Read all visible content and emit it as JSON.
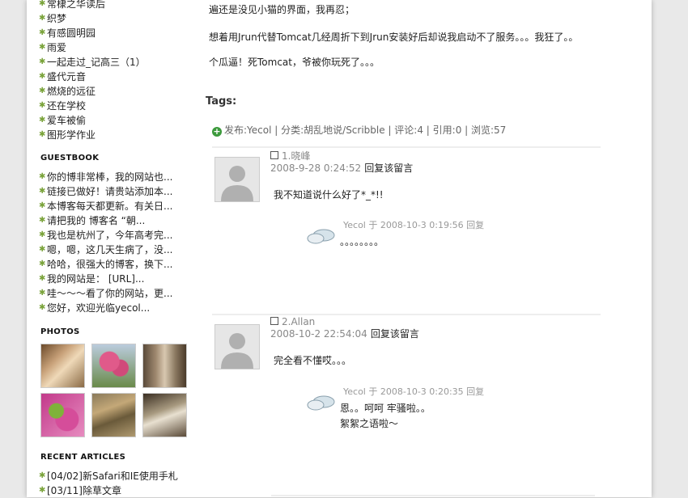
{
  "sidebar": {
    "top_links": [
      "常棣之华读后",
      "织梦",
      "有感圆明园",
      "雨爱",
      "一起走过_记高三（1）",
      "盛代元音",
      "燃烧的远征",
      "还在学校",
      "爱车被偷",
      "图形学作业"
    ],
    "guestbook_title": "GUESTBOOK",
    "guestbook": [
      "你的博非常棒，我的网站也...",
      "链接已做好！请贵站添加本...",
      "本博客每天都更新。有关日...",
      "请把我的 博客名 “朝...",
      "我也是杭州了，今年高考完...",
      "嗯，嗯，这几天生病了，没...",
      "哈哈，很强大的博客，换下...",
      "我的网站是： [URL]...",
      "哇～～～看了你的网站，更...",
      "您好，欢迎光临yecol..."
    ],
    "photos_title": "PHOTOS",
    "photos": [
      "book-photo",
      "pink-flowers-photo",
      "alley-photo",
      "pink-blossom-photo",
      "leaves-photo",
      "sign-photo"
    ],
    "recent_title": "RECENT ARTICLES",
    "recent": [
      "[04/02]新Safari和IE使用手札",
      "[03/11]除草文章"
    ]
  },
  "post": {
    "lines": [
      "遍还是没见小猫的界面，我再忍；",
      "想着用Jrun代替Tomcat几经周折下到Jrun安装好后却说我启动不了服务。。。我狂了。。",
      "个瓜逼！死Tomcat，爷被你玩死了。。。"
    ],
    "tags_label": "Tags:",
    "meta": "发布:Yecol | 分类:胡乱地说/Scribble | 评论:4 | 引用:0 | 浏览:57"
  },
  "comments": [
    {
      "author": "1.晓峰",
      "date": "2008-9-28 0:24:52",
      "reply_label": "回复该留言",
      "body": "我不知道说什么好了*_*!!",
      "reply": {
        "head": "Yecol 于 2008-10-3 0:19:56 回复",
        "lines": [
          "。。。。。。。。"
        ]
      }
    },
    {
      "author": "2.Allan",
      "date": "2008-10-2 22:54:04",
      "reply_label": "回复该留言",
      "body": "完全看不懂哎。。。",
      "reply": {
        "head": "Yecol 于 2008-10-3 0:20:35 回复",
        "lines": [
          "恩。。呵呵 牢骚啦。。",
          "絮絮之语啦～"
        ]
      }
    }
  ],
  "colors": {
    "star": "#7aa33b",
    "plus": "#3c9a3c"
  }
}
